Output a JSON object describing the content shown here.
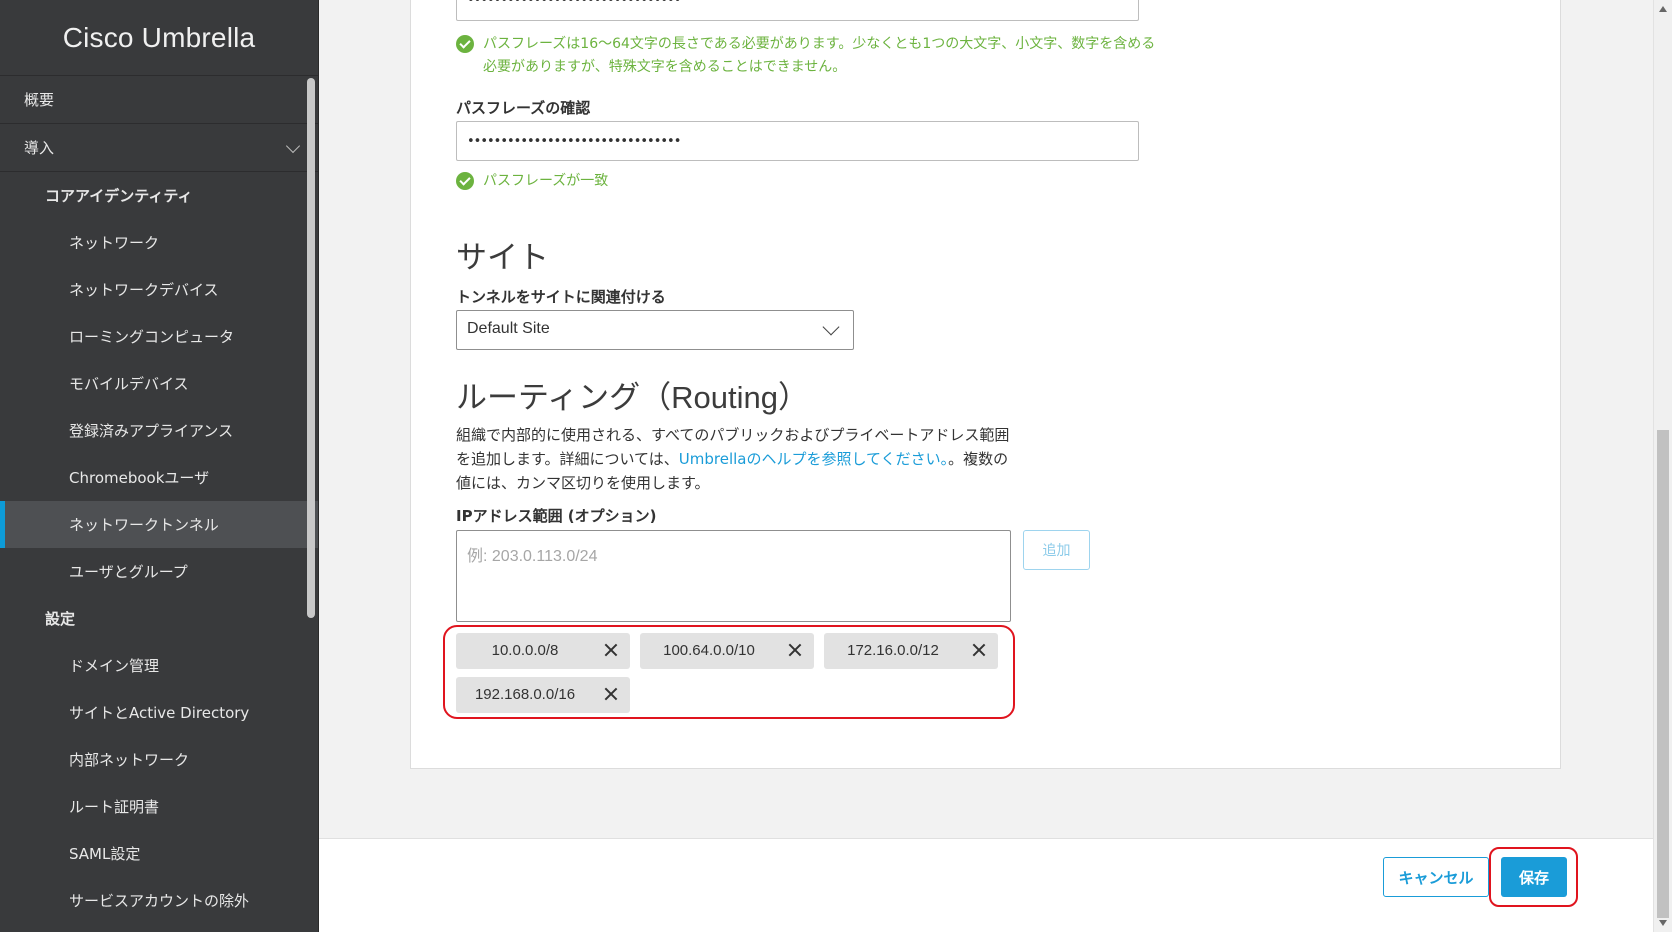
{
  "app": {
    "title": "Cisco Umbrella"
  },
  "sidebar": {
    "items": [
      {
        "label": "概要",
        "level": "top"
      },
      {
        "label": "導入",
        "level": "top",
        "expanded": true
      },
      {
        "label": "コアアイデンティティ",
        "level": "group"
      },
      {
        "label": "ネットワーク",
        "level": "sub"
      },
      {
        "label": "ネットワークデバイス",
        "level": "sub"
      },
      {
        "label": "ローミングコンピュータ",
        "level": "sub"
      },
      {
        "label": "モバイルデバイス",
        "level": "sub"
      },
      {
        "label": "登録済みアプライアンス",
        "level": "sub"
      },
      {
        "label": "Chromebookユーザ",
        "level": "sub"
      },
      {
        "label": "ネットワークトンネル",
        "level": "sub",
        "active": true
      },
      {
        "label": "ユーザとグループ",
        "level": "sub"
      },
      {
        "label": "設定",
        "level": "group"
      },
      {
        "label": "ドメイン管理",
        "level": "sub"
      },
      {
        "label": "サイトとActive Directory",
        "level": "sub"
      },
      {
        "label": "内部ネットワーク",
        "level": "sub"
      },
      {
        "label": "ルート証明書",
        "level": "sub"
      },
      {
        "label": "SAML設定",
        "level": "sub"
      },
      {
        "label": "サービスアカウントの除外",
        "level": "sub"
      }
    ]
  },
  "form": {
    "passphrase": {
      "masked_value": "••••••••••••••••••••••••••••••••",
      "hint_line1": "パスフレーズは16～64文字の長さである必要があります。少なくとも1つの大文字、小文字、数字を含める",
      "hint_line2": "必要がありますが、特殊文字を含めることはできません。"
    },
    "confirm": {
      "label": "パスフレーズの確認",
      "masked_value": "••••••••••••••••••••••••••••••••",
      "match_text": "パスフレーズが一致"
    },
    "site": {
      "section_title": "サイト",
      "label": "トンネルをサイトに関連付ける",
      "selected": "Default Site"
    },
    "routing": {
      "section_title": "ルーティング（Routing）",
      "desc_part1": "組織で内部的に使用される、すべてのパブリックおよびプライベートアドレス範囲を追加します。詳細については、",
      "desc_link": "Umbrellaのヘルプを参照してください。",
      "desc_part2": "。複数の値には、カンマ区切りを使用します。",
      "ip_label": "IPアドレス範囲 (オプション)",
      "ip_placeholder": "例: 203.0.113.0/24",
      "add_label": "追加",
      "ranges": [
        "10.0.0.0/8",
        "100.64.0.0/10",
        "172.16.0.0/12",
        "192.168.0.0/16"
      ]
    }
  },
  "footer": {
    "cancel_label": "キャンセル",
    "save_label": "保存"
  },
  "colors": {
    "accent": "#1a9cd8",
    "success": "#6cb33f",
    "highlight": "#e0141e",
    "sidebar_bg": "#393a3c"
  }
}
